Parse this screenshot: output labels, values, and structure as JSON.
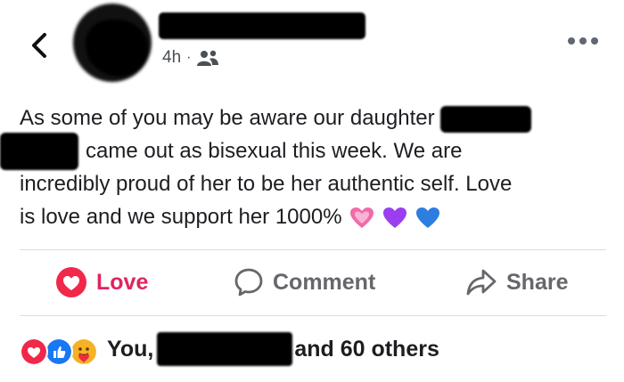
{
  "header": {
    "time": "4h",
    "separator": "·",
    "audience_icon": "friends-icon",
    "back_icon": "chevron-left-icon",
    "more_icon": "more-horizontal-icon"
  },
  "post": {
    "line1": "As some of you may be aware our daughter",
    "line2": "came out as bisexual this week. We are",
    "line3": "incredibly proud of her to be her authentic self. Love",
    "line4": "is love and we support her 1000%",
    "emojis": [
      "growing-heart-emoji",
      "purple-heart-emoji",
      "blue-heart-emoji"
    ]
  },
  "actions": {
    "love_label": "Love",
    "comment_label": "Comment",
    "share_label": "Share"
  },
  "reactions": {
    "icons": [
      "love-reaction-icon",
      "like-reaction-icon",
      "care-reaction-icon"
    ],
    "prefix": "You,",
    "suffix": "and 60 others"
  },
  "colors": {
    "love": "#e0245e",
    "like": "#1877f2",
    "muted": "#65676b",
    "text": "#1c1e21",
    "divider": "#dadde1"
  }
}
